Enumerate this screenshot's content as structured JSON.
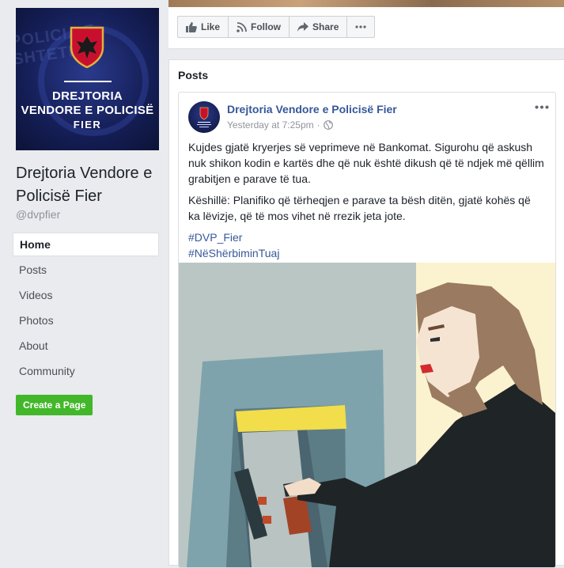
{
  "page": {
    "name": "Drejtoria Vendore e Policisë Fier",
    "handle": "@dvpfier",
    "profile_pic_text": {
      "line1": "DREJTORIA",
      "line2": "VENDORE E POLICISË",
      "line3": "FIER",
      "background_text": "POLICIA E SHTETIT"
    }
  },
  "nav": {
    "items": [
      {
        "label": "Home",
        "active": true
      },
      {
        "label": "Posts"
      },
      {
        "label": "Videos"
      },
      {
        "label": "Photos"
      },
      {
        "label": "About"
      },
      {
        "label": "Community"
      }
    ]
  },
  "create_page_label": "Create a Page",
  "actions": {
    "like_label": "Like",
    "follow_label": "Follow",
    "share_label": "Share",
    "more_icon": "more-horizontal-icon"
  },
  "posts_section": {
    "title": "Posts"
  },
  "post": {
    "author": "Drejtoria Vendore e Policisë Fier",
    "timestamp": "Yesterday at 7:25pm",
    "separator": "·",
    "audience_icon": "globe-icon",
    "paragraph1": "Kujdes gjatë kryerjes së veprimeve në Bankomat. Sigurohu që askush nuk shikon kodin e kartës dhe që nuk është dikush që të ndjek më qëllim grabitjen e parave të tua.",
    "paragraph2": "Këshillë: Planifiko që tërheqjen e parave ta bësh ditën, gjatë kohës që ka lëvizje, që të mos vihet në rrezik jeta jote.",
    "hashtags": [
      "#DVP_Fier",
      "#NëShërbiminTuaj"
    ]
  },
  "colors": {
    "background": "#e9ebee",
    "link_blue": "#365899",
    "create_green": "#42b72a"
  }
}
